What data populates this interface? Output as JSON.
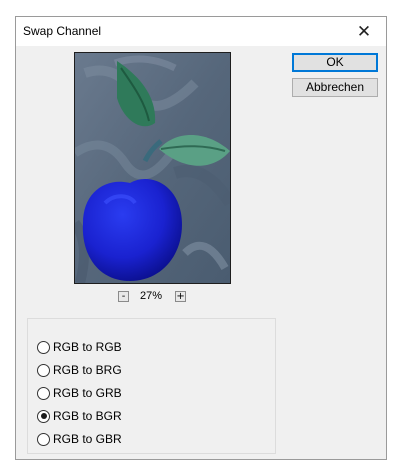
{
  "dialog": {
    "title": "Swap Channel",
    "close_glyph": "✕"
  },
  "buttons": {
    "ok_label": "OK",
    "cancel_label": "Abbrechen"
  },
  "preview": {
    "zoom_out": "-",
    "zoom_level": "27%",
    "zoom_in": "+"
  },
  "options": [
    {
      "label": "RGB to RGB",
      "checked": false
    },
    {
      "label": "RGB to BRG",
      "checked": false
    },
    {
      "label": "RGB to GRB",
      "checked": false
    },
    {
      "label": "RGB to BGR",
      "checked": true
    },
    {
      "label": "RGB to GBR",
      "checked": false
    }
  ],
  "colors": {
    "window_bg": "#f0f0f0",
    "accent": "#0078d7",
    "fruit": "#1a24d6",
    "leaf": "#2f7a5a",
    "background_paint": "#5e6e82"
  }
}
